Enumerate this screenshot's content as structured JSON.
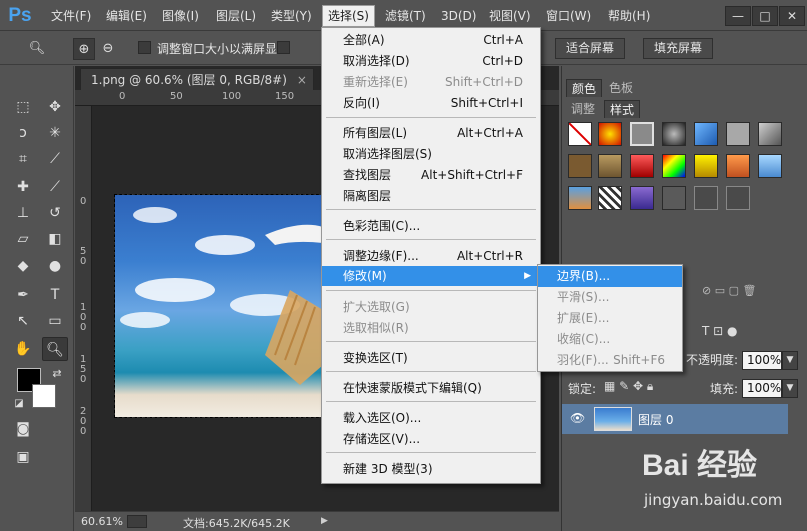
{
  "app": {
    "logo": "Ps"
  },
  "menubar": {
    "items": [
      {
        "label": "文件(F)"
      },
      {
        "label": "编辑(E)"
      },
      {
        "label": "图像(I)"
      },
      {
        "label": "图层(L)"
      },
      {
        "label": "类型(Y)"
      },
      {
        "label": "选择(S)"
      },
      {
        "label": "滤镜(T)"
      },
      {
        "label": "3D(D)"
      },
      {
        "label": "视图(V)"
      },
      {
        "label": "窗口(W)"
      },
      {
        "label": "帮助(H)"
      }
    ],
    "active": "选择(S)",
    "window_controls": [
      "—",
      "□",
      "✕"
    ]
  },
  "optionsbar": {
    "resize_windows_label": "调整窗口大小以满屏显示",
    "fit_screen_button": "适合屏幕",
    "fill_screen_button": "填充屏幕"
  },
  "document": {
    "tab_title": "1.png @ 60.6% (图层 0, RGB/8#)",
    "tab_close": "×",
    "ruler_top": [
      "0",
      "50",
      "100",
      "150"
    ],
    "ruler_left": [
      "0",
      "5",
      "0",
      "1",
      "0",
      "0",
      "1",
      "5",
      "0",
      "2",
      "0",
      "0"
    ]
  },
  "statusbar": {
    "zoom": "60.61%",
    "doc_info": "文档:645.2K/645.2K"
  },
  "select_menu": {
    "items": [
      {
        "label": "全部(A)",
        "shortcut": "Ctrl+A",
        "disabled": false
      },
      {
        "label": "取消选择(D)",
        "shortcut": "Ctrl+D",
        "disabled": false
      },
      {
        "label": "重新选择(E)",
        "shortcut": "Shift+Ctrl+D",
        "disabled": true
      },
      {
        "label": "反向(I)",
        "shortcut": "Shift+Ctrl+I",
        "disabled": false
      },
      {
        "label": "所有图层(L)",
        "shortcut": "Alt+Ctrl+A",
        "disabled": false
      },
      {
        "label": "取消选择图层(S)",
        "shortcut": "",
        "disabled": false
      },
      {
        "label": "查找图层",
        "shortcut": "Alt+Shift+Ctrl+F",
        "disabled": false
      },
      {
        "label": "隔离图层",
        "shortcut": "",
        "disabled": false
      },
      {
        "label": "色彩范围(C)...",
        "shortcut": "",
        "disabled": false
      },
      {
        "label": "调整边缘(F)...",
        "shortcut": "Alt+Ctrl+R",
        "disabled": false
      },
      {
        "label": "修改(M)",
        "shortcut": "",
        "disabled": false,
        "highlighted": true,
        "has_submenu": true
      },
      {
        "label": "扩大选取(G)",
        "shortcut": "",
        "disabled": true
      },
      {
        "label": "选取相似(R)",
        "shortcut": "",
        "disabled": true
      },
      {
        "label": "变换选区(T)",
        "shortcut": "",
        "disabled": false
      },
      {
        "label": "在快速蒙版模式下编辑(Q)",
        "shortcut": "",
        "disabled": false
      },
      {
        "label": "载入选区(O)...",
        "shortcut": "",
        "disabled": false
      },
      {
        "label": "存储选区(V)...",
        "shortcut": "",
        "disabled": false
      },
      {
        "label": "新建 3D 模型(3)",
        "shortcut": "",
        "disabled": false
      }
    ]
  },
  "modify_submenu": {
    "items": [
      {
        "label": "边界(B)...",
        "shortcut": "",
        "highlighted": true
      },
      {
        "label": "平滑(S)...",
        "shortcut": ""
      },
      {
        "label": "扩展(E)...",
        "shortcut": ""
      },
      {
        "label": "收缩(C)...",
        "shortcut": ""
      },
      {
        "label": "羽化(F)...",
        "shortcut": "Shift+F6"
      }
    ]
  },
  "panels": {
    "top_tabs": [
      "颜色",
      "色板"
    ],
    "style_tabs": [
      "调整",
      "样式"
    ],
    "opacity_label": "不透明度:",
    "opacity_value": "100%",
    "lock_label": "锁定:",
    "fill_label": "填充:",
    "fill_value": "100%",
    "layer_name": "图层 0"
  },
  "watermark": {
    "logo": "Bai 经验",
    "url": "jingyan.baidu.com"
  },
  "colors": {
    "accent": "#3390e8",
    "menu_bg": "#f0f0f0",
    "ui_bg": "#535353",
    "layer_highlight": "#5b7ca2"
  }
}
